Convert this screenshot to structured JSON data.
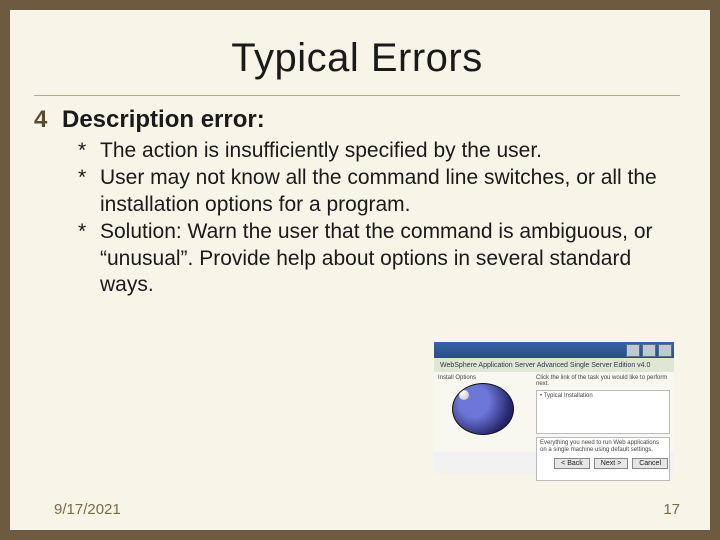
{
  "title": "Typical Errors",
  "bullet1_marker": "4",
  "bullet1": "Description error:",
  "sub": {
    "a": "The action is insufficiently specified by the user.",
    "b": "User may not know all the command line switches, or all the installation options for a program.",
    "c": "Solution: Warn the user that the command is ambiguous, or “unusual”. Provide help about options in several standard ways."
  },
  "figure": {
    "band": "WebSphere Application Server Advanced Single Server Edition v4.0",
    "hint": "Click the link of the task you would like to perform next.",
    "opt1": "• Typical Installation",
    "opt2_a": "Everything you need to run Web applications",
    "opt2_b": "on a single machine using default settings.",
    "btn_back": "< Back",
    "btn_next": "Next >",
    "btn_cancel": "Cancel"
  },
  "footer": {
    "date": "9/17/2021",
    "page": "17"
  }
}
